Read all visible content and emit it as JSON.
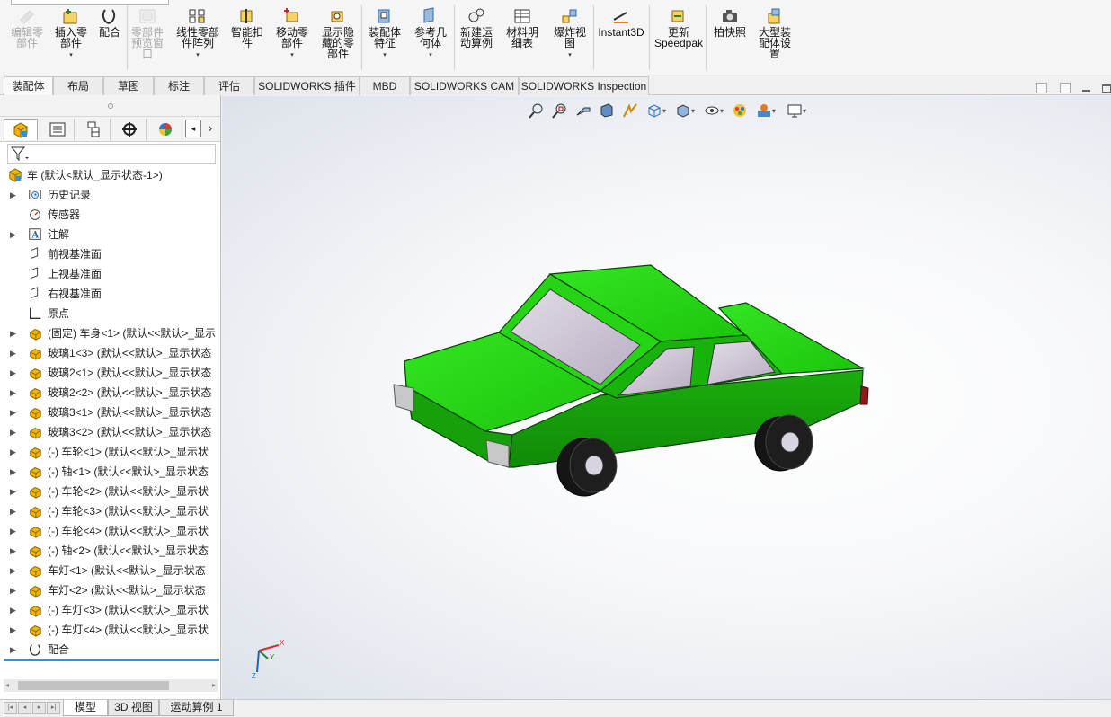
{
  "ribbon": {
    "buttons": [
      {
        "label": "编辑零\n部件",
        "icon": "edit-component-icon",
        "disabled": true
      },
      {
        "label": "插入零\n部件",
        "icon": "insert-components-icon",
        "dropdown": true
      },
      {
        "label": "配合",
        "icon": "mate-icon"
      },
      {
        "label": "零部件\n预览窗\n口",
        "icon": "component-preview-icon",
        "disabled": true
      },
      {
        "label": "线性零部\n件阵列",
        "icon": "linear-pattern-icon",
        "dropdown": true
      },
      {
        "label": "智能扣\n件",
        "icon": "smart-fasteners-icon"
      },
      {
        "label": "移动零\n部件",
        "icon": "move-component-icon",
        "dropdown": true
      },
      {
        "label": "显示隐\n藏的零\n部件",
        "icon": "show-hidden-icon"
      },
      {
        "label": "装配体\n特征",
        "icon": "assembly-features-icon",
        "dropdown": true
      },
      {
        "label": "参考几\n何体",
        "icon": "reference-geometry-icon",
        "dropdown": true
      },
      {
        "label": "新建运\n动算例",
        "icon": "motion-study-icon"
      },
      {
        "label": "材料明\n细表",
        "icon": "bom-icon"
      },
      {
        "label": "爆炸视\n图",
        "icon": "exploded-view-icon",
        "dropdown": true
      },
      {
        "label": "Instant3D",
        "icon": "instant3d-icon"
      },
      {
        "label": "更新\nSpeedpak",
        "icon": "speedpak-icon"
      },
      {
        "label": "拍快照",
        "icon": "snapshot-icon"
      },
      {
        "label": "大型装\n配体设\n置",
        "icon": "large-assembly-icon"
      }
    ]
  },
  "cmd_tabs": [
    "装配体",
    "布局",
    "草图",
    "标注",
    "评估",
    "SOLIDWORKS 插件",
    "MBD",
    "SOLIDWORKS CAM",
    "SOLIDWORKS Inspection"
  ],
  "active_cmd_tab": "装配体",
  "tree": {
    "root": "车 (默认<默认_显示状态-1>)",
    "items": [
      {
        "label": "历史记录",
        "icon": "history-icon",
        "expander": true
      },
      {
        "label": "传感器",
        "icon": "sensor-icon",
        "expander": false
      },
      {
        "label": "注解",
        "icon": "annotation-icon",
        "expander": true
      },
      {
        "label": "前视基准面",
        "icon": "plane-icon",
        "expander": false
      },
      {
        "label": "上视基准面",
        "icon": "plane-icon",
        "expander": false
      },
      {
        "label": "右视基准面",
        "icon": "plane-icon",
        "expander": false
      },
      {
        "label": "原点",
        "icon": "origin-icon",
        "expander": false
      },
      {
        "label": "(固定) 车身<1> (默认<<默认>_显示",
        "icon": "part-icon",
        "expander": true
      },
      {
        "label": "玻璃1<3> (默认<<默认>_显示状态",
        "icon": "part-icon",
        "expander": true
      },
      {
        "label": "玻璃2<1> (默认<<默认>_显示状态",
        "icon": "part-icon",
        "expander": true
      },
      {
        "label": "玻璃2<2> (默认<<默认>_显示状态",
        "icon": "part-icon",
        "expander": true
      },
      {
        "label": "玻璃3<1> (默认<<默认>_显示状态",
        "icon": "part-icon",
        "expander": true
      },
      {
        "label": "玻璃3<2> (默认<<默认>_显示状态",
        "icon": "part-icon",
        "expander": true
      },
      {
        "label": "(-) 车轮<1> (默认<<默认>_显示状",
        "icon": "part-icon",
        "expander": true
      },
      {
        "label": "(-) 轴<1> (默认<<默认>_显示状态",
        "icon": "part-icon",
        "expander": true
      },
      {
        "label": "(-) 车轮<2> (默认<<默认>_显示状",
        "icon": "part-icon",
        "expander": true
      },
      {
        "label": "(-) 车轮<3> (默认<<默认>_显示状",
        "icon": "part-icon",
        "expander": true
      },
      {
        "label": "(-) 车轮<4> (默认<<默认>_显示状",
        "icon": "part-icon",
        "expander": true
      },
      {
        "label": "(-) 轴<2> (默认<<默认>_显示状态",
        "icon": "part-icon",
        "expander": true
      },
      {
        "label": "车灯<1> (默认<<默认>_显示状态",
        "icon": "part-icon",
        "expander": true
      },
      {
        "label": "车灯<2> (默认<<默认>_显示状态",
        "icon": "part-icon",
        "expander": true
      },
      {
        "label": "(-) 车灯<3> (默认<<默认>_显示状",
        "icon": "part-icon",
        "expander": true
      },
      {
        "label": "(-) 车灯<4> (默认<<默认>_显示状",
        "icon": "part-icon",
        "expander": true
      },
      {
        "label": "配合",
        "icon": "mates-folder-icon",
        "expander": true
      }
    ]
  },
  "triad": {
    "x": "X",
    "y": "Y",
    "z": "Z"
  },
  "bottom_tabs": [
    "模型",
    "3D 视图",
    "运动算例 1"
  ],
  "active_bottom_tab": "模型",
  "colors": {
    "car_body": "#1fd10f",
    "car_body_dark": "#12a00a",
    "glass": "#cfc7d6",
    "tire": "#1a1a1a",
    "accent": "#3a8ed0"
  }
}
